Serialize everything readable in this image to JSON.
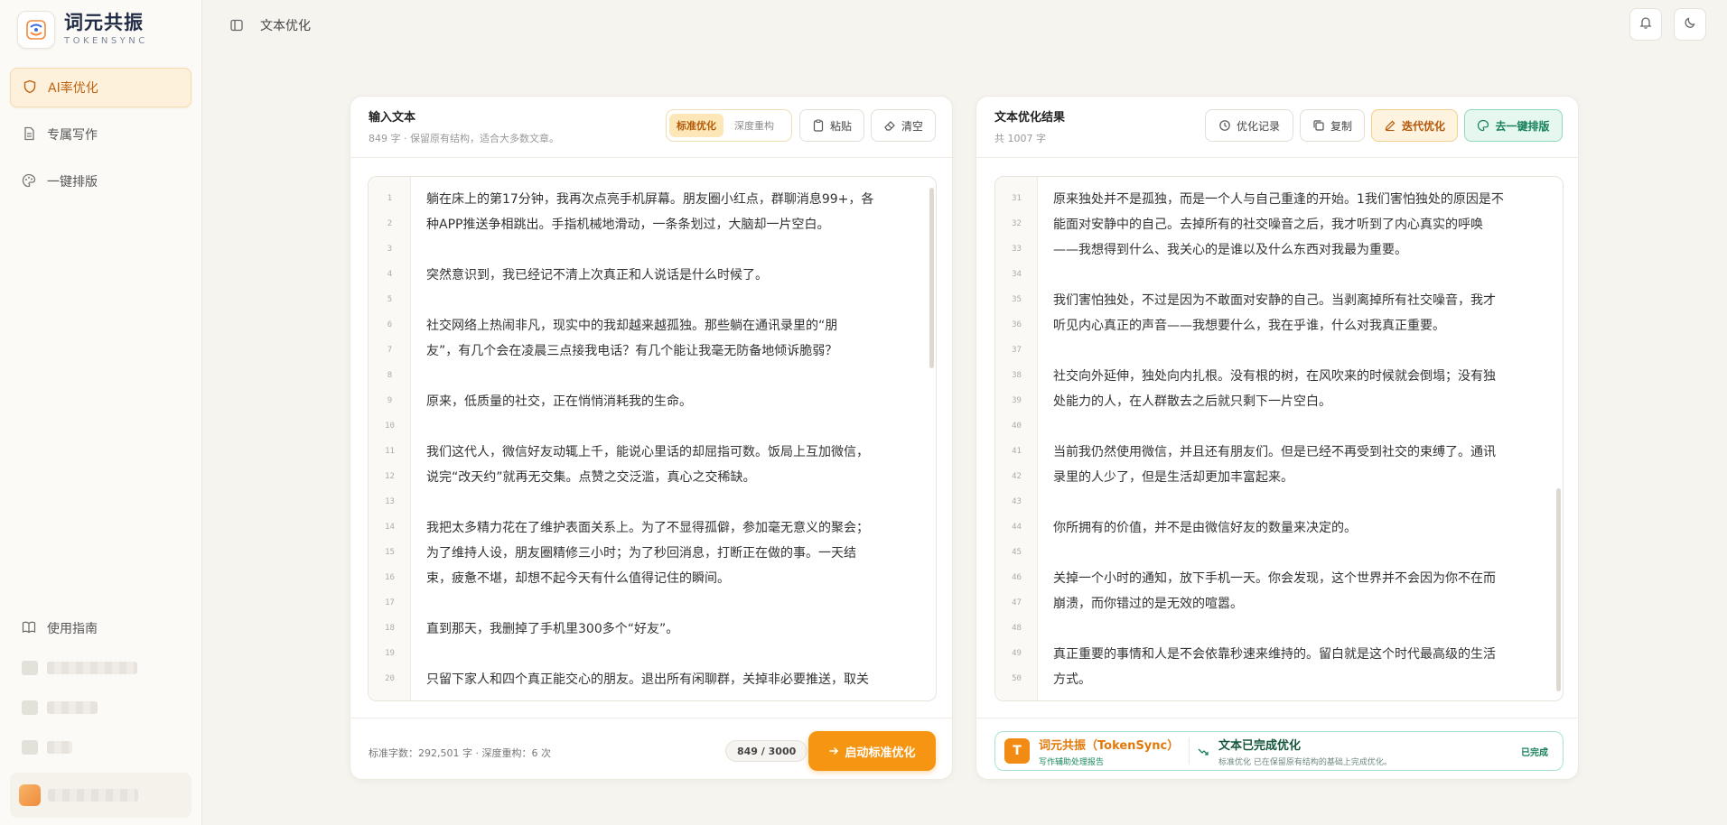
{
  "brand": {
    "name": "词元共振",
    "sub": "TOKENSYNC"
  },
  "sidebar": {
    "items": [
      {
        "label": "AI率优化",
        "icon": "shield-icon",
        "active": true
      },
      {
        "label": "专属写作",
        "icon": "document-icon",
        "active": false
      },
      {
        "label": "一键排版",
        "icon": "palette-icon",
        "active": false
      }
    ],
    "guide": {
      "label": "使用指南",
      "icon": "book-icon"
    }
  },
  "topbar": {
    "title": "文本优化"
  },
  "input": {
    "title": "输入文本",
    "sub": "849 字 · 保留原有结构，适合大多数文章。",
    "modes": [
      "标准优化",
      "深度重构"
    ],
    "paste_label": "粘贴",
    "clear_label": "清空",
    "lines": [
      {
        "n": "1",
        "t": "躺在床上的第17分钟，我再次点亮手机屏幕。朋友圈小红点，群聊消息99+，各"
      },
      {
        "n": "2",
        "t": "种APP推送争相跳出。手指机械地滑动，一条条划过，大脑却一片空白。"
      },
      {
        "n": "3",
        "t": ""
      },
      {
        "n": "4",
        "t": "突然意识到，我已经记不清上次真正和人说话是什么时候了。"
      },
      {
        "n": "5",
        "t": ""
      },
      {
        "n": "6",
        "t": "社交网络上热闹非凡，现实中的我却越来越孤独。那些躺在通讯录里的“朋"
      },
      {
        "n": "7",
        "t": "友”，有几个会在凌晨三点接我电话？有几个能让我毫无防备地倾诉脆弱？"
      },
      {
        "n": "8",
        "t": ""
      },
      {
        "n": "9",
        "t": "原来，低质量的社交，正在悄悄消耗我的生命。"
      },
      {
        "n": "10",
        "t": ""
      },
      {
        "n": "11",
        "t": "我们这代人，微信好友动辄上千，能说心里话的却屈指可数。饭局上互加微信，"
      },
      {
        "n": "12",
        "t": "说完“改天约”就再无交集。点赞之交泛滥，真心之交稀缺。"
      },
      {
        "n": "13",
        "t": ""
      },
      {
        "n": "14",
        "t": "我把太多精力花在了维护表面关系上。为了不显得孤僻，参加毫无意义的聚会；"
      },
      {
        "n": "15",
        "t": "为了维持人设，朋友圈精修三小时；为了秒回消息，打断正在做的事。一天结"
      },
      {
        "n": "16",
        "t": "束，疲惫不堪，却想不起今天有什么值得记住的瞬间。"
      },
      {
        "n": "17",
        "t": ""
      },
      {
        "n": "18",
        "t": "直到那天，我删掉了手机里300多个“好友”。"
      },
      {
        "n": "19",
        "t": ""
      },
      {
        "n": "20",
        "t": "只留下家人和四个真正能交心的朋友。退出所有闲聊群，关掉非必要推送，取关"
      }
    ],
    "footer_stats": "标准字数：292,501 字 · 深度重构：6 次",
    "counter": "849 / 3000",
    "start_label": "启动标准优化"
  },
  "result": {
    "title": "文本优化结果",
    "sub": "共 1007 字",
    "history_label": "优化记录",
    "copy_label": "复制",
    "iterate_label": "迭代优化",
    "layout_label": "去一键排版",
    "lines": [
      {
        "n": "31",
        "t": "原来独处并不是孤独，而是一个人与自己重逢的开始。1我们害怕独处的原因是不"
      },
      {
        "n": "32",
        "t": "能面对安静中的自己。去掉所有的社交噪音之后，我才听到了内心真实的呼唤"
      },
      {
        "n": "33",
        "t": "——我想得到什么、我关心的是谁以及什么东西对我最为重要。"
      },
      {
        "n": "34",
        "t": ""
      },
      {
        "n": "35",
        "t": "我们害怕独处，不过是因为不敢面对安静的自己。当剥离掉所有社交噪音，我才"
      },
      {
        "n": "36",
        "t": "听见内心真正的声音——我想要什么，我在乎谁，什么对我真正重要。"
      },
      {
        "n": "37",
        "t": ""
      },
      {
        "n": "38",
        "t": "社交向外延伸，独处向内扎根。没有根的树，在风吹来的时候就会倒塌；没有独"
      },
      {
        "n": "39",
        "t": "处能力的人，在人群散去之后就只剩下一片空白。"
      },
      {
        "n": "40",
        "t": ""
      },
      {
        "n": "41",
        "t": "当前我仍然使用微信，并且还有朋友们。但是已经不再受到社交的束缚了。通讯"
      },
      {
        "n": "42",
        "t": "录里的人少了，但是生活却更加丰富起来。"
      },
      {
        "n": "43",
        "t": ""
      },
      {
        "n": "44",
        "t": "你所拥有的价值，并不是由微信好友的数量来决定的。"
      },
      {
        "n": "45",
        "t": ""
      },
      {
        "n": "46",
        "t": "关掉一个小时的通知，放下手机一天。你会发现，这个世界并不会因为你不在而"
      },
      {
        "n": "47",
        "t": "崩溃，而你错过的是无效的喧嚣。"
      },
      {
        "n": "48",
        "t": ""
      },
      {
        "n": "49",
        "t": "真正重要的事情和人是不会依靠秒速来维持的。留白就是这个时代最高级的生活"
      },
      {
        "n": "50",
        "t": "方式。"
      }
    ],
    "report": {
      "logo_letter": "T",
      "brand": "词元共振（TokenSync）",
      "brand_sub": "写作辅助处理报告",
      "status_title": "文本已完成优化",
      "status_sub": "标准优化   已在保留原有结构的基础上完成优化。",
      "done": "已完成"
    }
  },
  "colors": {
    "accent": "#f59512",
    "success": "#17825a",
    "bg": "#f6f4ef"
  }
}
